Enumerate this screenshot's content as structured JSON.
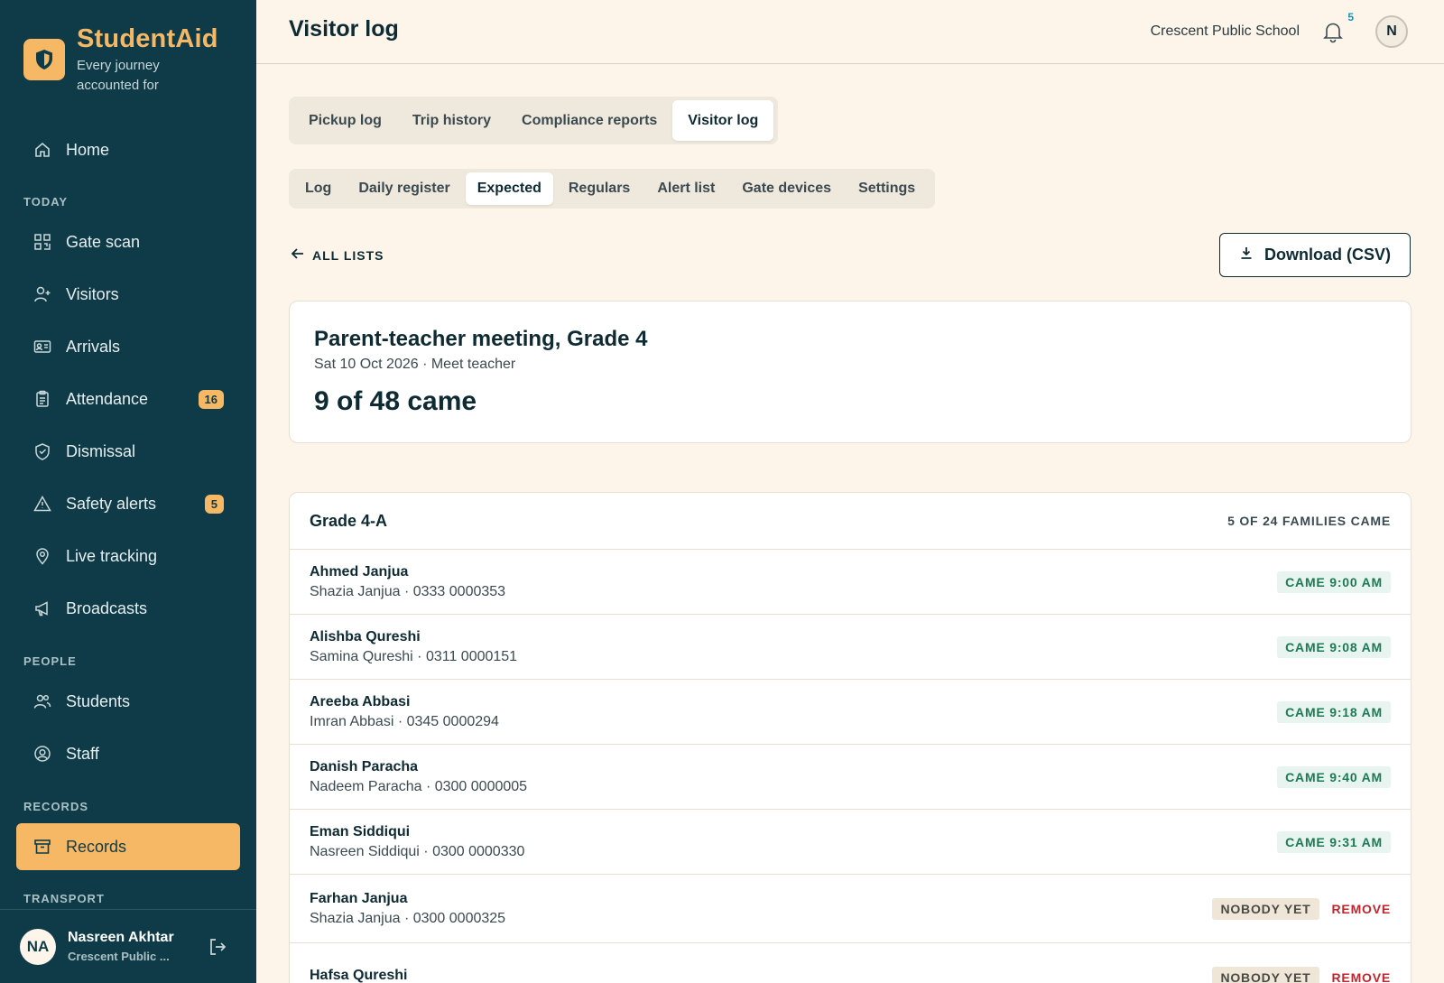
{
  "brand": {
    "name": "StudentAid",
    "tagline_1": "Every journey",
    "tagline_2": "accounted for",
    "logo_icon": "shield-icon"
  },
  "sidebar": {
    "home": {
      "label": "Home",
      "icon": "home-icon"
    },
    "sections": {
      "today": "TODAY",
      "people": "PEOPLE",
      "records": "RECORDS",
      "transport": "TRANSPORT"
    },
    "today_items": [
      {
        "label": "Gate scan",
        "icon": "qr-icon"
      },
      {
        "label": "Visitors",
        "icon": "user-plus-icon"
      },
      {
        "label": "Arrivals",
        "icon": "id-card-icon"
      },
      {
        "label": "Attendance",
        "icon": "clipboard-icon",
        "badge": "16"
      },
      {
        "label": "Dismissal",
        "icon": "shield-check-icon"
      },
      {
        "label": "Safety alerts",
        "icon": "alert-triangle-icon",
        "badge": "5"
      },
      {
        "label": "Live tracking",
        "icon": "map-pin-icon"
      },
      {
        "label": "Broadcasts",
        "icon": "megaphone-icon"
      }
    ],
    "people_items": [
      {
        "label": "Students",
        "icon": "users-icon"
      },
      {
        "label": "Staff",
        "icon": "user-circle-icon"
      }
    ],
    "records_item": {
      "label": "Records",
      "icon": "archive-icon"
    },
    "user": {
      "initials": "NA",
      "name": "Nasreen Akhtar",
      "school": "Crescent Public ..."
    }
  },
  "header": {
    "title": "Visitor log",
    "school": "Crescent Public School",
    "notification_count": "5",
    "avatar_initial": "N"
  },
  "tabs_primary": [
    "Pickup log",
    "Trip history",
    "Compliance reports",
    "Visitor log"
  ],
  "tabs_secondary": [
    "Log",
    "Daily register",
    "Expected",
    "Regulars",
    "Alert list",
    "Gate devices",
    "Settings"
  ],
  "back_link": "ALL LISTS",
  "download_label": "Download (CSV)",
  "summary": {
    "title": "Parent-teacher meeting, Grade 4",
    "subtitle": "Sat 10 Oct 2026 · Meet teacher",
    "count": "9 of 48 came"
  },
  "group": {
    "title": "Grade 4-A",
    "count": "5 OF 24 FAMILIES CAME",
    "rows": [
      {
        "name": "Ahmed Janjua",
        "sub": "Shazia Janjua · 0333 0000353",
        "status": "CAME 9:00 AM"
      },
      {
        "name": "Alishba Qureshi",
        "sub": "Samina Qureshi · 0311 0000151",
        "status": "CAME 9:08 AM"
      },
      {
        "name": "Areeba Abbasi",
        "sub": "Imran Abbasi · 0345 0000294",
        "status": "CAME 9:18 AM"
      },
      {
        "name": "Danish Paracha",
        "sub": "Nadeem Paracha · 0300 0000005",
        "status": "CAME 9:40 AM"
      },
      {
        "name": "Eman Siddiqui",
        "sub": "Nasreen Siddiqui · 0300 0000330",
        "status": "CAME 9:31 AM"
      },
      {
        "name": "Farhan Janjua",
        "sub": "Shazia Janjua · 0300 0000325",
        "status": "NOBODY YET",
        "action": "REMOVE"
      },
      {
        "name": "Hafsa Qureshi",
        "sub": "",
        "status": "NOBODY YET",
        "action": "REMOVE"
      }
    ]
  },
  "colors": {
    "sidebar_bg": "#0e3b47",
    "accent": "#f7b865",
    "page_bg": "#fdf5ea",
    "came_green": "#1e7a55",
    "remove_red": "#c0262d"
  }
}
